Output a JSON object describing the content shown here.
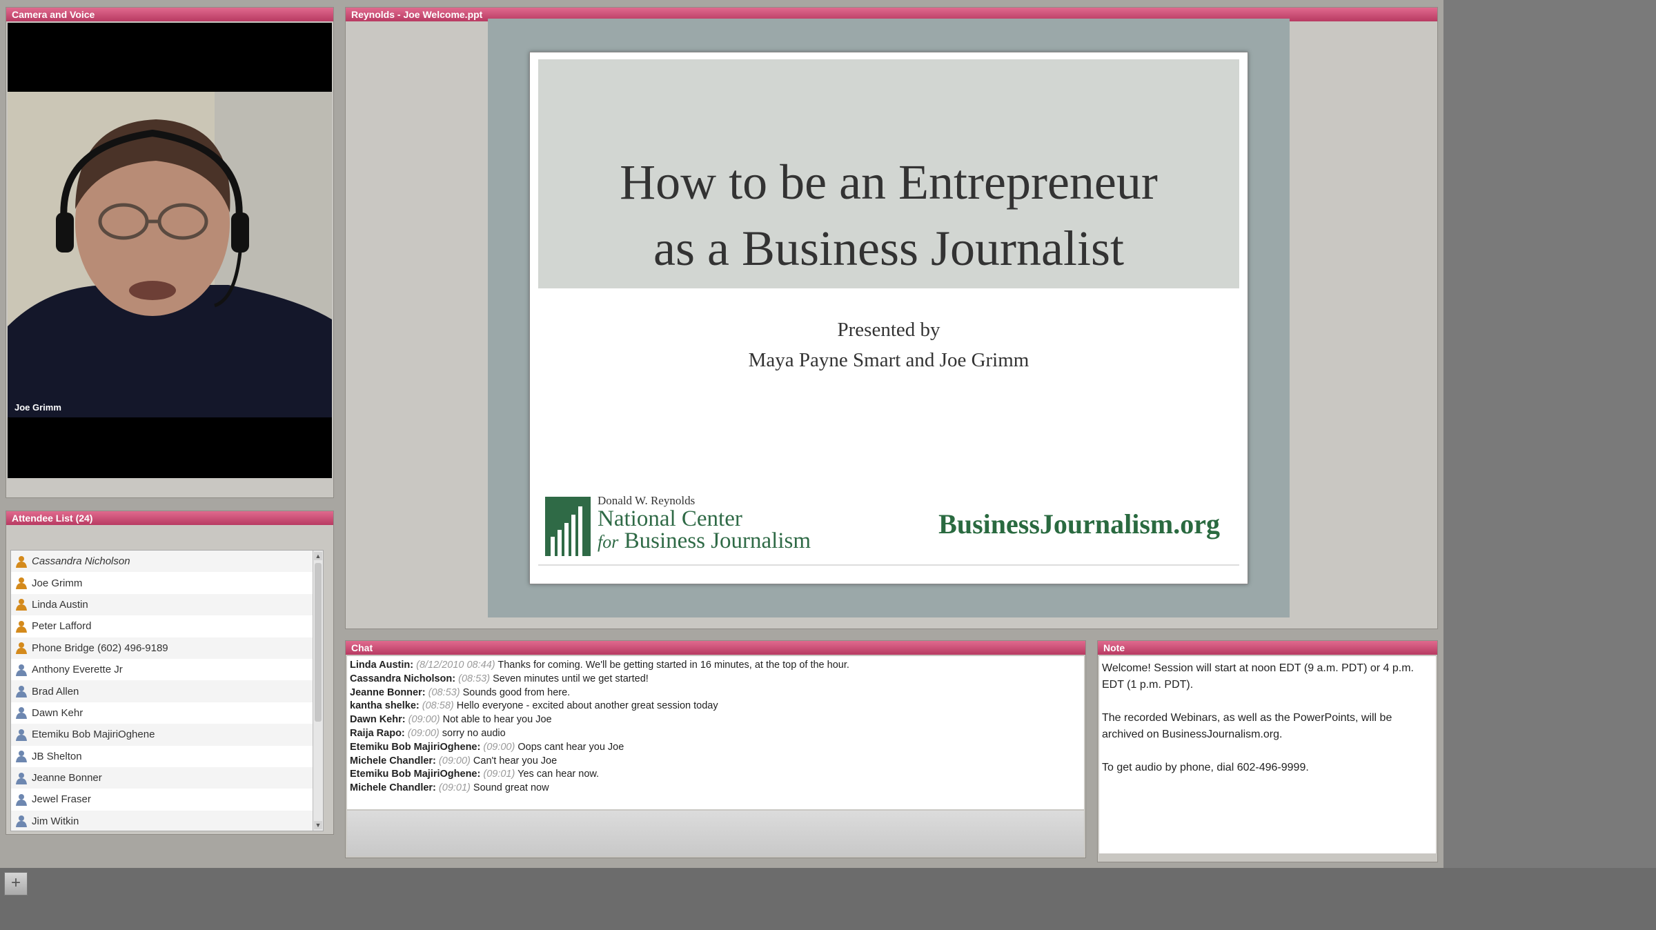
{
  "camera": {
    "title": "Camera and Voice",
    "speaker": "Joe Grimm"
  },
  "attendees": {
    "title": "Attendee List (24)",
    "list": [
      {
        "name": "Cassandra Nicholson",
        "role": "host"
      },
      {
        "name": "Joe Grimm",
        "role": "host"
      },
      {
        "name": "Linda  Austin",
        "role": "host"
      },
      {
        "name": "Peter Lafford",
        "role": "host"
      },
      {
        "name": "Phone Bridge (602) 496-9189",
        "role": "host"
      },
      {
        "name": "Anthony Everette Jr",
        "role": "participant"
      },
      {
        "name": "Brad Allen",
        "role": "participant"
      },
      {
        "name": "Dawn Kehr",
        "role": "participant"
      },
      {
        "name": "Etemiku Bob MajiriOghene",
        "role": "participant"
      },
      {
        "name": "JB Shelton",
        "role": "participant"
      },
      {
        "name": "Jeanne Bonner",
        "role": "participant"
      },
      {
        "name": "Jewel Fraser",
        "role": "participant"
      },
      {
        "name": "Jim Witkin",
        "role": "participant"
      }
    ]
  },
  "share": {
    "title": "Reynolds - Joe Welcome.ppt",
    "slide": {
      "title_line1": "How to be an Entrepreneur",
      "title_line2": "as a Business Journalist",
      "presented_by": "Presented by",
      "presenters": "Maya Payne Smart and Joe Grimm",
      "logo_small": "Donald W. Reynolds",
      "logo_line1": "National Center",
      "logo_line2_for": "for",
      "logo_line2": "Business Journalism",
      "site": "BusinessJournalism.org"
    }
  },
  "chat": {
    "title": "Chat",
    "messages": [
      {
        "who": "Linda  Austin:",
        "ts": "(8/12/2010 08:44)",
        "text": "Thanks for coming. We'll be getting started in 16 minutes, at the top of the hour."
      },
      {
        "who": "Cassandra Nicholson:",
        "ts": "(08:53)",
        "text": "Seven minutes until we get started!"
      },
      {
        "who": "Jeanne Bonner:",
        "ts": "(08:53)",
        "text": "Sounds good from here."
      },
      {
        "who": "kantha shelke:",
        "ts": "(08:58)",
        "text": "Hello everyone - excited about another great session today"
      },
      {
        "who": "Dawn Kehr:",
        "ts": "(09:00)",
        "text": "Not able to hear you Joe"
      },
      {
        "who": "Raija Rapo:",
        "ts": "(09:00)",
        "text": "sorry no audio"
      },
      {
        "who": "Etemiku Bob MajiriOghene:",
        "ts": "(09:00)",
        "text": "Oops cant hear you Joe"
      },
      {
        "who": "Michele Chandler:",
        "ts": "(09:00)",
        "text": "Can't hear you Joe"
      },
      {
        "who": "Etemiku Bob MajiriOghene:",
        "ts": "(09:01)",
        "text": "Yes can hear now."
      },
      {
        "who": "Michele Chandler:",
        "ts": "(09:01)",
        "text": "Sound great now"
      }
    ]
  },
  "note": {
    "title": "Note",
    "p1": "Welcome! Session will start at noon EDT (9 a.m. PDT) or 4 p.m. EDT (1 p.m. PDT).",
    "p2": "The recorded Webinars, as well as the PowerPoints, will be archived on BusinessJournalism.org.",
    "p3": "To get audio by phone, dial 602-496-9999."
  },
  "toolbar": {
    "add_label": "+"
  },
  "colors": {
    "pod_title": "#c8456e",
    "logo_green": "#2f6a46"
  }
}
